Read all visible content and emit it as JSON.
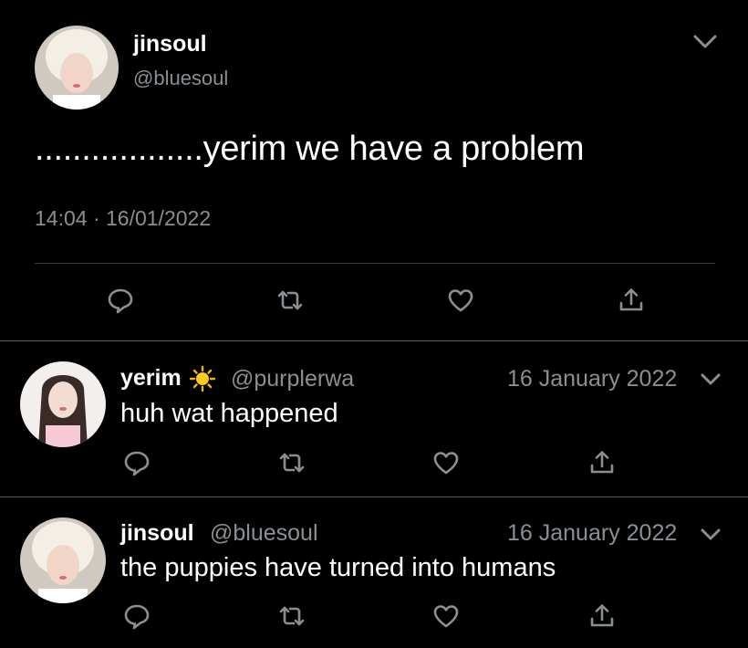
{
  "main_tweet": {
    "display_name": "jinsoul",
    "handle": "@bluesoul",
    "text": "..................yerim we have a problem",
    "timestamp": "14:04 · 16/01/2022",
    "menu_icon": "chevron-down-icon"
  },
  "action_icons": [
    "reply-icon",
    "retweet-icon",
    "like-icon",
    "share-icon"
  ],
  "replies": [
    {
      "display_name": "yerim",
      "emoji": "☀️",
      "handle": "@purplerwa",
      "date": "16 January 2022",
      "text": "huh wat happened"
    },
    {
      "display_name": "jinsoul",
      "handle": "@bluesoul",
      "date": "16 January 2022",
      "text": "the puppies have turned into humans"
    }
  ],
  "colors": {
    "background": "#000000",
    "text": "#ffffff",
    "muted": "#8a8f94",
    "divider": "#3a3d40"
  }
}
